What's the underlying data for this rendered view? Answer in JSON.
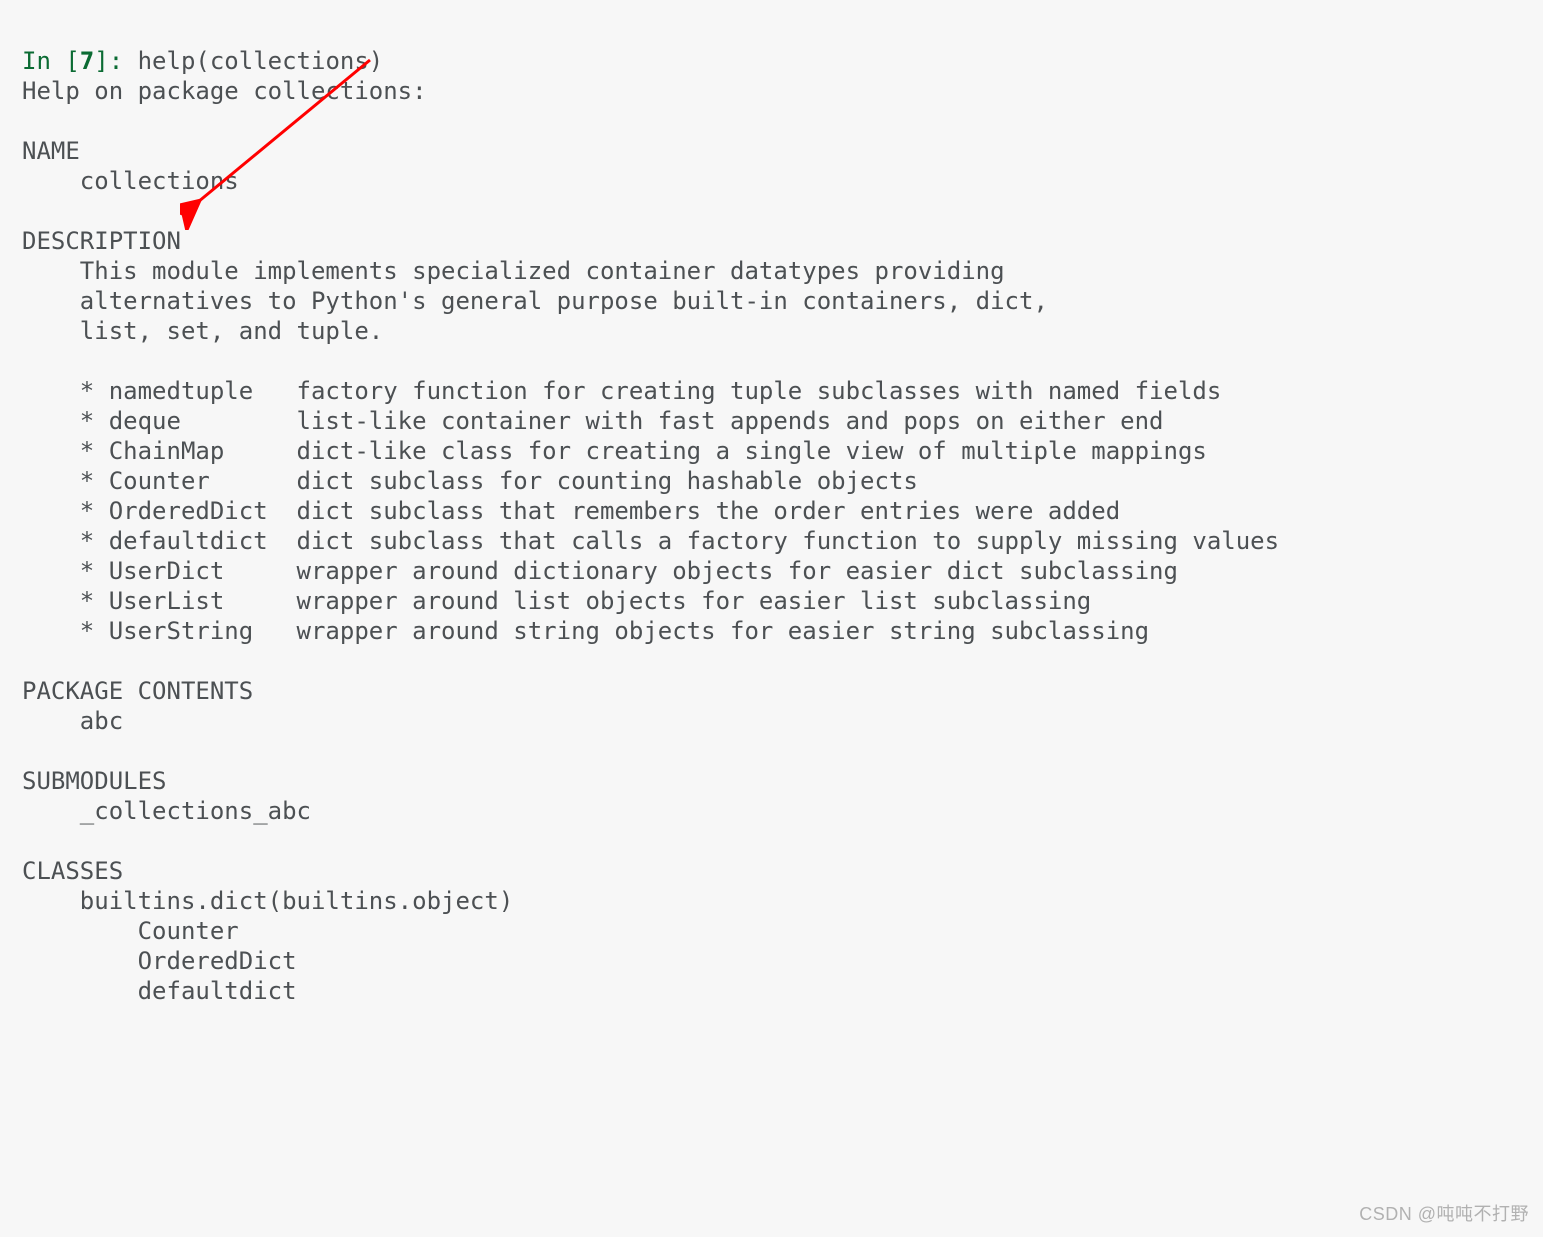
{
  "prompt": {
    "in_label": "In [",
    "number": "7",
    "close": "]: ",
    "code": "help(collections)"
  },
  "output": {
    "line1": "Help on package collections:",
    "blank": "",
    "name_hdr": "NAME",
    "name_val": "    collections",
    "desc_hdr": "DESCRIPTION",
    "desc_l1": "    This module implements specialized container datatypes providing",
    "desc_l2": "    alternatives to Python's general purpose built-in containers, dict,",
    "desc_l3": "    list, set, and tuple.",
    "item1": "    * namedtuple   factory function for creating tuple subclasses with named fields",
    "item2": "    * deque        list-like container with fast appends and pops on either end",
    "item3": "    * ChainMap     dict-like class for creating a single view of multiple mappings",
    "item4": "    * Counter      dict subclass for counting hashable objects",
    "item5": "    * OrderedDict  dict subclass that remembers the order entries were added",
    "item6": "    * defaultdict  dict subclass that calls a factory function to supply missing values",
    "item7": "    * UserDict     wrapper around dictionary objects for easier dict subclassing",
    "item8": "    * UserList     wrapper around list objects for easier list subclassing",
    "item9": "    * UserString   wrapper around string objects for easier string subclassing",
    "pkg_hdr": "PACKAGE CONTENTS",
    "pkg_val": "    abc",
    "sub_hdr": "SUBMODULES",
    "sub_val": "    _collections_abc",
    "cls_hdr": "CLASSES",
    "cls_l1": "    builtins.dict(builtins.object)",
    "cls_l2": "        Counter",
    "cls_l3": "        OrderedDict",
    "cls_l4": "        defaultdict"
  },
  "watermark": "CSDN @吨吨不打野"
}
